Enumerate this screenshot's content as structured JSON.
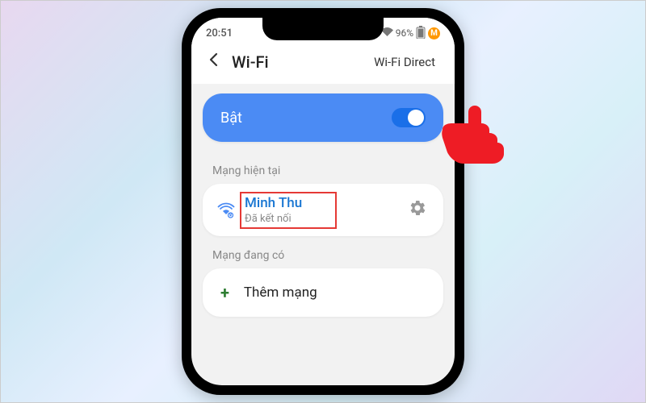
{
  "status_bar": {
    "time": "20:51",
    "battery_text": "96%",
    "profile_letter": "M"
  },
  "header": {
    "title": "Wi-Fi",
    "action": "Wi-Fi Direct"
  },
  "toggle": {
    "label": "Bật",
    "on": true
  },
  "sections": {
    "current": "Mạng hiện tại",
    "available": "Mạng đang có"
  },
  "current_network": {
    "name": "Minh Thu",
    "status": "Đã kết nối"
  },
  "add_network": {
    "label": "Thêm mạng"
  }
}
